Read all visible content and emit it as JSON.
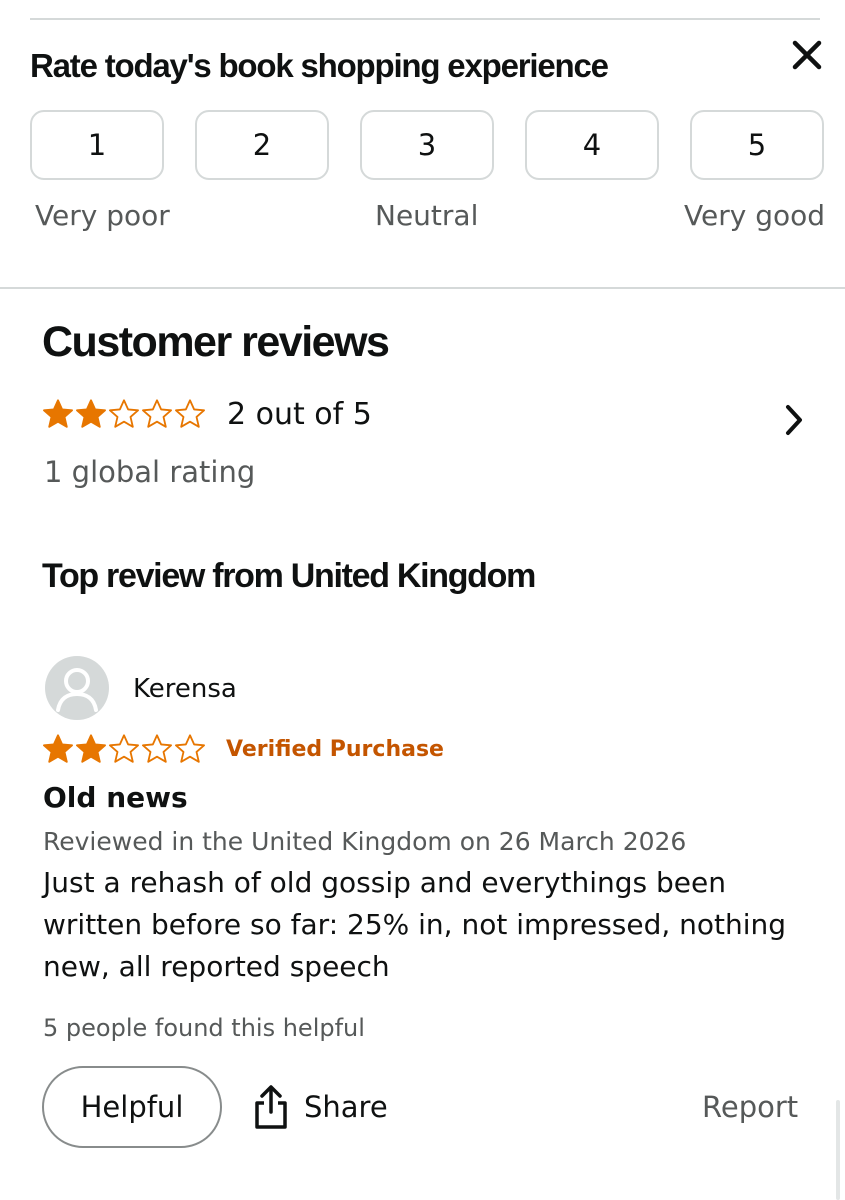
{
  "survey": {
    "title": "Rate today's book shopping experience",
    "close_icon": "close-icon",
    "options": [
      "1",
      "2",
      "3",
      "4",
      "5"
    ],
    "scale_low": "Very poor",
    "scale_mid": "Neutral",
    "scale_high": "Very good"
  },
  "reviews": {
    "title": "Customer reviews",
    "average_rating": 2,
    "max_rating": 5,
    "average_text": "2 out of 5",
    "global_ratings": "1 global rating",
    "chevron_icon": "chevron-right-icon",
    "top_review_heading": "Top review from United Kingdom"
  },
  "review": {
    "reviewer": "Kerensa",
    "avatar_icon": "user-avatar-icon",
    "rating": 2,
    "verified_label": "Verified Purchase",
    "title": "Old news",
    "date_line": "Reviewed in the United Kingdom on 26 March 2026",
    "body": "Just a rehash of old gossip and everythings been written before so far: 25% in, not impressed, nothing new, all reported speech",
    "helpful_count_text": "5 people found this helpful",
    "helpful_button": "Helpful",
    "share_button": "Share",
    "share_icon": "share-icon",
    "report_link": "Report"
  },
  "colors": {
    "star": "#e77600",
    "verified": "#c45500",
    "muted_text": "#565959",
    "border": "#d5d9d9"
  }
}
